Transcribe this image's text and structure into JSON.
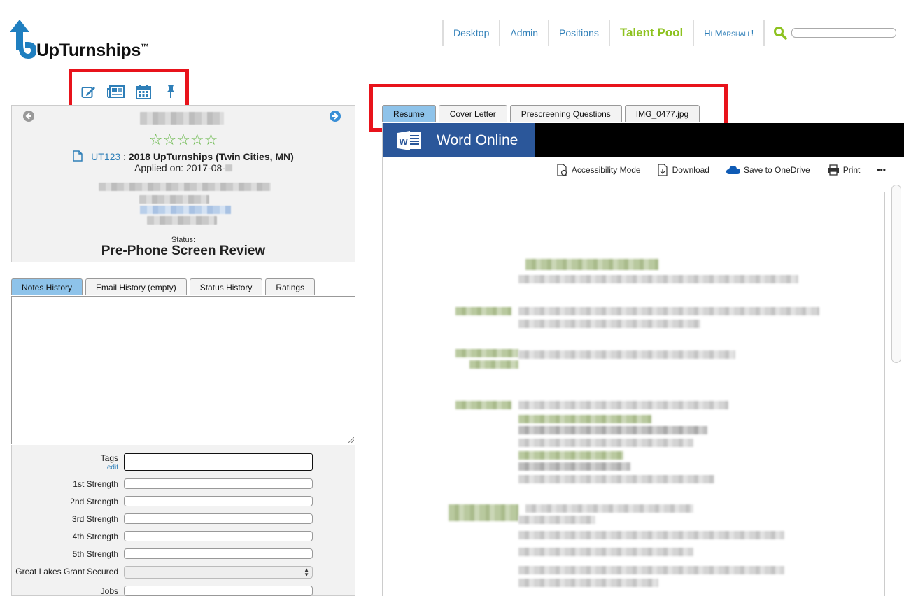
{
  "logo": {
    "text": "UpTurnships",
    "tm": "™"
  },
  "nav": {
    "items": [
      {
        "label": "Desktop",
        "active": false
      },
      {
        "label": "Admin",
        "active": false
      },
      {
        "label": "Positions",
        "active": false
      },
      {
        "label": "Talent Pool",
        "active": true
      },
      {
        "label": "Hi Marshall!",
        "active": false
      }
    ],
    "search_placeholder": ""
  },
  "toolbar": {
    "icons": [
      "edit-icon",
      "newspaper-icon",
      "calendar-icon",
      "pin-icon"
    ]
  },
  "candidate": {
    "rating_stars": "☆☆☆☆☆",
    "position_code": "UT123",
    "position_sep": " : ",
    "position_title": "2018 UpTurnships (Twin Cities, MN)",
    "applied_label": "Applied on: 2017-08-",
    "status_label": "Status:",
    "status_value": "Pre-Phone Screen Review"
  },
  "history_tabs": [
    {
      "label": "Notes History",
      "active": true
    },
    {
      "label": "Email History (empty)",
      "active": false
    },
    {
      "label": "Status History",
      "active": false
    },
    {
      "label": "Ratings",
      "active": false
    }
  ],
  "fields": {
    "tags_label": "Tags",
    "tags_edit": "edit",
    "strength1": "1st Strength",
    "strength2": "2nd Strength",
    "strength3": "3rd Strength",
    "strength4": "4th Strength",
    "strength5": "5th Strength",
    "grant": "Great Lakes Grant Secured",
    "jobs": "Jobs"
  },
  "doc_tabs": [
    {
      "label": "Resume",
      "active": true
    },
    {
      "label": "Cover Letter",
      "active": false
    },
    {
      "label": "Prescreening Questions",
      "active": false
    },
    {
      "label": "IMG_0477.jpg",
      "active": false
    }
  ],
  "word": {
    "title": "Word Online",
    "accessibility": "Accessibility Mode",
    "download": "Download",
    "onedrive": "Save to OneDrive",
    "print": "Print",
    "more": "•••"
  },
  "colors": {
    "accent_blue": "#2f7fb8",
    "nav_active_green": "#8dc21f",
    "tab_active": "#8ec3ea",
    "highlight_red": "#e8131b",
    "word_blue": "#2b579a",
    "star_green": "#68b84a"
  }
}
